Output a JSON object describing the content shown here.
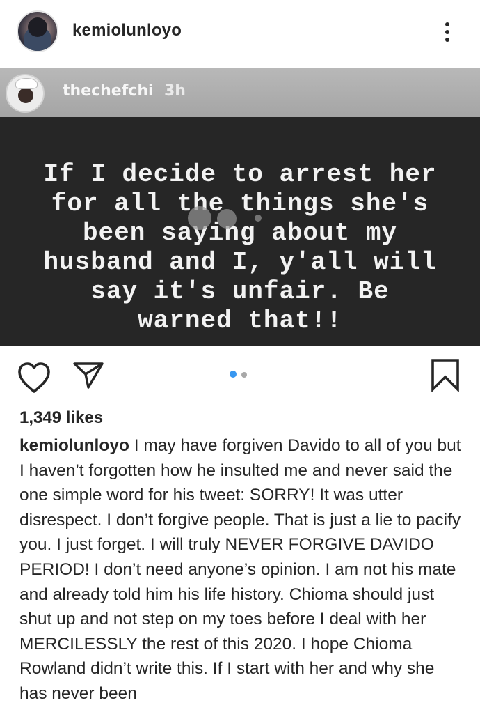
{
  "post": {
    "username": "kemiolunloyo",
    "more_icon": "more-vertical-icon"
  },
  "story": {
    "username": "thechefchi",
    "time": "3h",
    "text": "If I decide to arrest her\nfor all the things she's\nbeen saying about my\nhusband and I, y'all will\nsay it's unfair. Be\nwarned that!!"
  },
  "actions": {
    "like_icon": "heart-icon",
    "share_icon": "direct-send-icon",
    "save_icon": "bookmark-icon",
    "carousel_count": 2,
    "carousel_active_index": 0,
    "carousel_active_color": "#3897f0"
  },
  "likes": {
    "text": "1,349 likes"
  },
  "caption": {
    "username": "kemiolunloyo",
    "text": "I may have forgiven Davido to all of you but I haven’t forgotten how he insulted me and never said the one simple word for his tweet: SORRY! It was utter disrespect. I don’t forgive people. That is just a lie to pacify you. I just forget. I will truly NEVER FORGIVE DAVIDO PERIOD! I don’t need anyone’s opinion. I am not his mate and already told him his life history. Chioma should just shut up and not step on my toes before I deal with her MERCILESSLY the rest of this 2020. I hope Chioma Rowland didn’t write this. If I start with her and why she has never been"
  }
}
